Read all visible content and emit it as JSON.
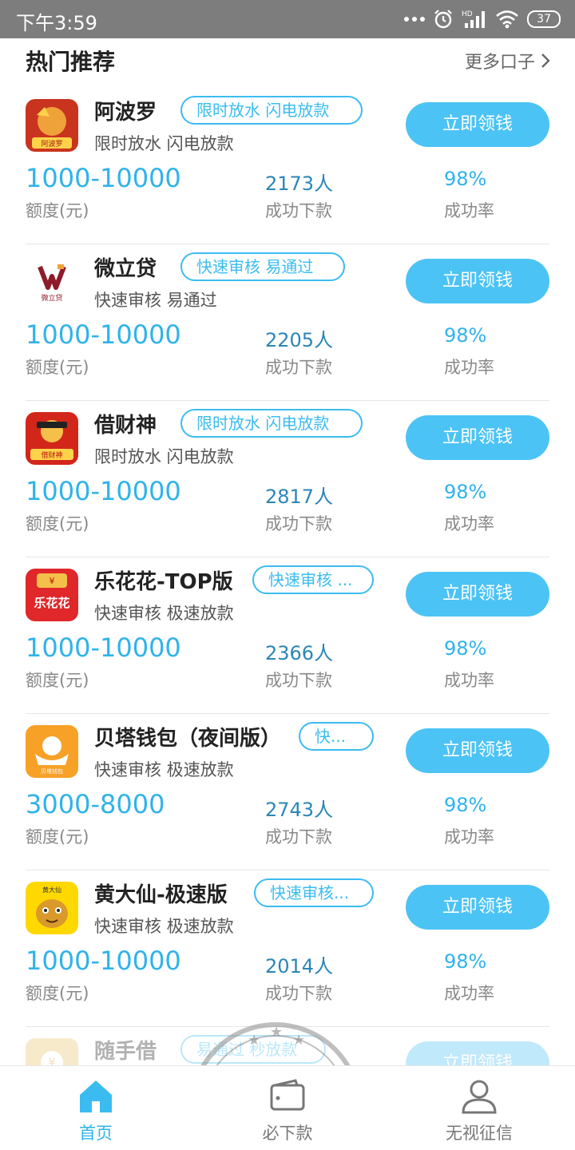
{
  "status_bar": {
    "time": "下午3:59",
    "network": "HD",
    "battery": "37"
  },
  "section": {
    "title": "热门推荐",
    "more_label": "更多口子"
  },
  "colors": {
    "accent": "#4cc3f5",
    "accent_text": "#2fb3ea",
    "count_text": "#2b86b8",
    "status_bar": "#7d7d7d"
  },
  "loans": [
    {
      "name": "阿波罗",
      "tag": "限时放水 闪电放款",
      "desc": "限时放水 闪电放款",
      "cta": "立即领钱",
      "amount": "1000-10000",
      "amount_label": "额度(元)",
      "count": "2173人",
      "count_label": "成功下款",
      "rate": "98%",
      "rate_label": "成功率",
      "logo_text": "阿波罗"
    },
    {
      "name": "微立贷",
      "tag": "快速审核 易通过",
      "desc": "快速审核 易通过",
      "cta": "立即领钱",
      "amount": "1000-10000",
      "amount_label": "额度(元)",
      "count": "2205人",
      "count_label": "成功下款",
      "rate": "98%",
      "rate_label": "成功率",
      "logo_text": "微立贷"
    },
    {
      "name": "借财神",
      "tag": "限时放水 闪电放款",
      "desc": "限时放水 闪电放款",
      "cta": "立即领钱",
      "amount": "1000-10000",
      "amount_label": "额度(元)",
      "count": "2817人",
      "count_label": "成功下款",
      "rate": "98%",
      "rate_label": "成功率",
      "logo_text": "借财神"
    },
    {
      "name": "乐花花-TOP版",
      "tag": "快速审核 ...",
      "desc": "快速审核 极速放款",
      "cta": "立即领钱",
      "amount": "1000-10000",
      "amount_label": "额度(元)",
      "count": "2366人",
      "count_label": "成功下款",
      "rate": "98%",
      "rate_label": "成功率",
      "logo_text": "乐花花"
    },
    {
      "name": "贝塔钱包（夜间版）",
      "tag": "快...",
      "desc": "快速审核 极速放款",
      "cta": "立即领钱",
      "amount": "3000-8000",
      "amount_label": "额度(元)",
      "count": "2743人",
      "count_label": "成功下款",
      "rate": "98%",
      "rate_label": "成功率",
      "logo_text": "贝塔钱包"
    },
    {
      "name": "黄大仙-极速版",
      "tag": "快速审核...",
      "desc": "快速审核 极速放款",
      "cta": "立即领钱",
      "amount": "1000-10000",
      "amount_label": "额度(元)",
      "count": "2014人",
      "count_label": "成功下款",
      "rate": "98%",
      "rate_label": "成功率",
      "logo_text": "黄大仙"
    },
    {
      "name": "随手借",
      "tag": "易通过 秒放款",
      "desc": "",
      "cta": "立即领钱",
      "amount": "",
      "amount_label": "",
      "count": "",
      "count_label": "",
      "rate": "",
      "rate_label": "",
      "logo_text": ""
    }
  ],
  "tabs": [
    {
      "label": "首页",
      "icon": "home-icon",
      "active": true
    },
    {
      "label": "必下款",
      "icon": "wallet-icon",
      "active": false
    },
    {
      "label": "无视征信",
      "icon": "user-icon",
      "active": false
    }
  ]
}
